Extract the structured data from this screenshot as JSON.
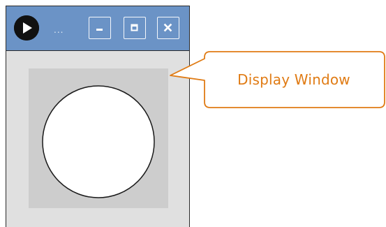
{
  "window": {
    "title": "...",
    "controls": {
      "minimize_icon": "minimize-icon",
      "maximize_icon": "maximize-icon",
      "close_icon": "close-icon"
    },
    "app_icon": "play-icon"
  },
  "content": {
    "shape": "circle"
  },
  "callout": {
    "label": "Display Window"
  },
  "colors": {
    "titlebar": "#6b93c6",
    "window_background": "#e0e0e0",
    "canvas_background": "#cdcdcd",
    "circle_fill": "#ffffff",
    "callout_accent": "#e07b14"
  }
}
